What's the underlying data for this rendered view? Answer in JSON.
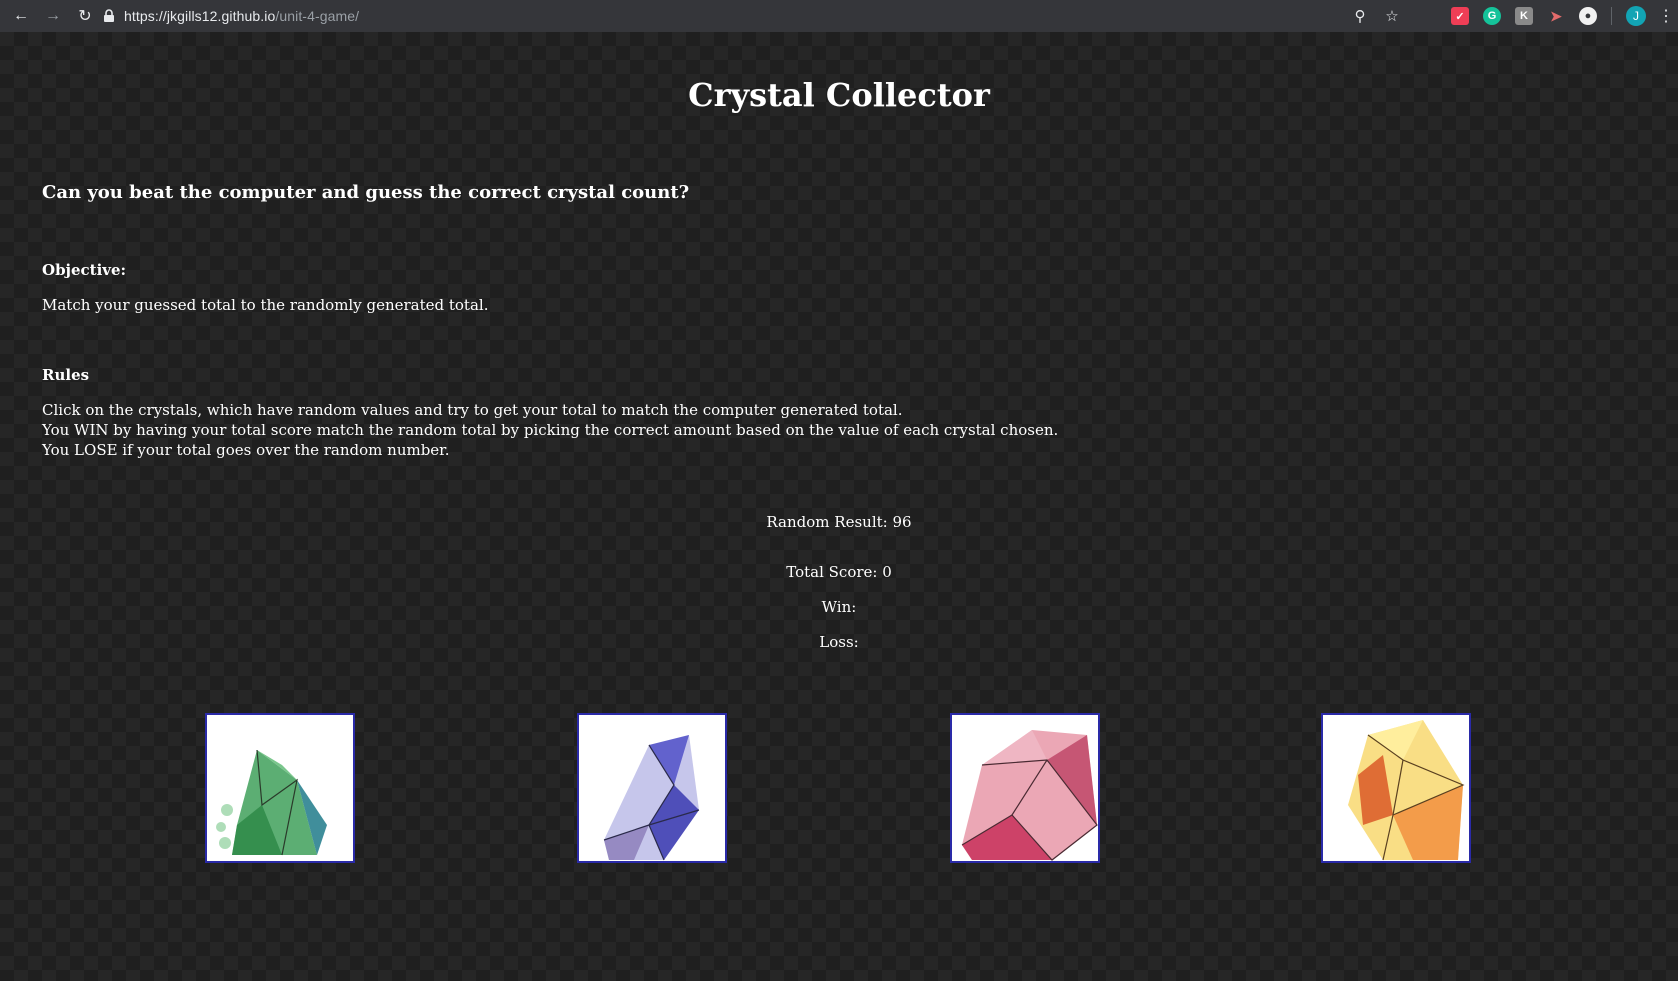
{
  "browser": {
    "url_host": "https://jkgills12.github.io",
    "url_path": "/unit-4-game/",
    "icons": [
      "back-icon",
      "forward-icon",
      "reload-icon",
      "lock-icon",
      "zoom-icon",
      "star-icon",
      "pocket-extension-icon",
      "grammarly-extension-icon",
      "kanji-extension-icon",
      "flash-extension-icon",
      "circle-extension-icon",
      "profile-avatar",
      "menu-icon"
    ],
    "avatar_initial": "J"
  },
  "page": {
    "title": "Crystal Collector",
    "question": "Can you beat the computer and guess the correct crystal count?",
    "objective_heading": "Objective:",
    "objective_text": "Match your guessed total to the randomly generated total.",
    "rules_heading": "Rules",
    "rules": [
      "Click on the crystals, which have random values and try to get your total to match the computer generated total.",
      "You WIN by having your total score match the random total by picking the correct amount based on the value of each crystal chosen.",
      "You LOSE if your total goes over the random number."
    ],
    "random_result": "Random Result: 96",
    "total_score": "Total Score: 0",
    "win": "Win:",
    "loss": "Loss:"
  },
  "crystals": [
    {
      "name": "green-crystal",
      "color": "#2e9a4a"
    },
    {
      "name": "blue-crystal",
      "color": "#4a4ab8"
    },
    {
      "name": "pink-crystal",
      "color": "#d8506e"
    },
    {
      "name": "yellow-crystal",
      "color": "#f2a23a"
    }
  ],
  "colors": {
    "background": "#262626",
    "text": "#ffffff",
    "crystal_border": "#2a2aa8"
  }
}
